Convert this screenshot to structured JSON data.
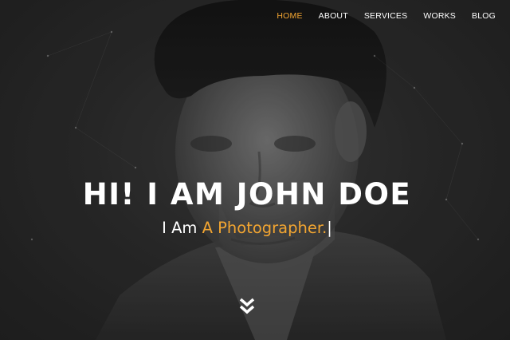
{
  "nav": {
    "items": [
      {
        "label": "HOME",
        "active": true
      },
      {
        "label": "ABOUT",
        "active": false
      },
      {
        "label": "SERVICES",
        "active": false
      },
      {
        "label": "WORKS",
        "active": false
      },
      {
        "label": "BLOG",
        "active": false
      }
    ]
  },
  "hero": {
    "headline": "HI! I AM JOHN DOE",
    "subline_prefix": "I Am",
    "subline_role": "A Photographer.",
    "cursor": "|",
    "scroll_icon": "double-chevron-down-icon"
  },
  "colors": {
    "accent": "#f2a531",
    "text": "#ffffff",
    "background": "#2a2a2a"
  }
}
